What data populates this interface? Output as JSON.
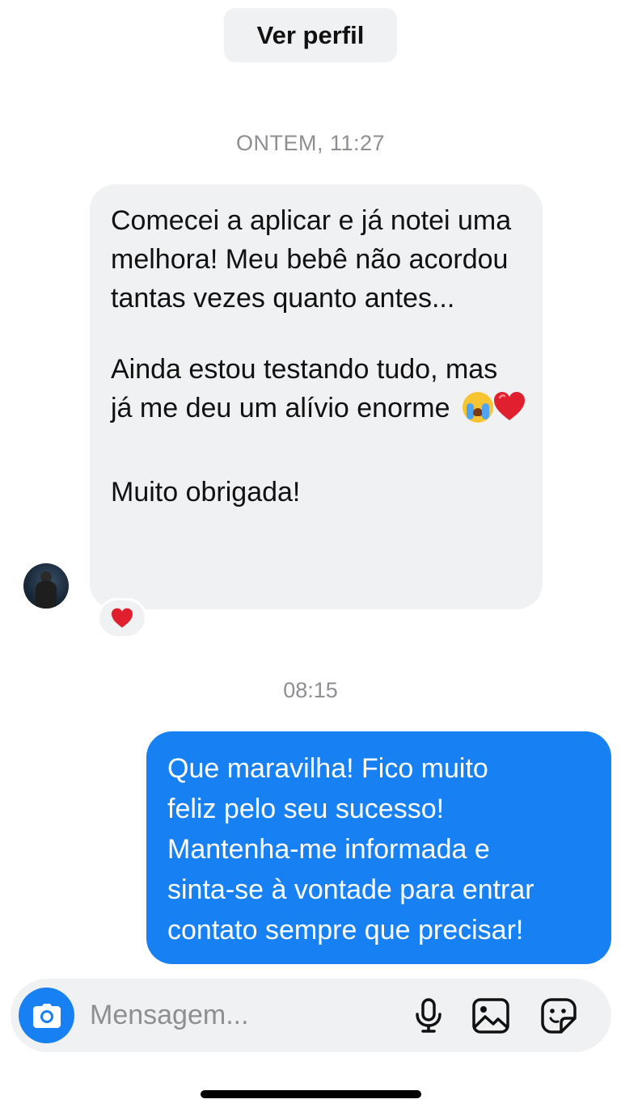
{
  "header": {
    "view_profile_label": "Ver perfil"
  },
  "conversation": {
    "timestamp_1": "ONTEM, 11:27",
    "incoming_message": {
      "paragraph_1": "Comecei a aplicar e já notei uma melhora! Meu bebê não acordou tantas vezes quanto antes...",
      "paragraph_2": "Ainda estou testando tudo, mas já me deu um alívio enorme",
      "paragraph_2_emojis": [
        "sob-emoji",
        "red-heart-emoji"
      ],
      "paragraph_3": "Muito obrigada!",
      "reaction": "red-heart-emoji"
    },
    "timestamp_2": "08:15",
    "outgoing_message": {
      "text": "Que maravilha! Fico muito\nfeliz pelo seu sucesso!\nMantenha-me informada e\nsinta-se à vontade para entrar\ncontato sempre que precisar!"
    }
  },
  "composer": {
    "placeholder": "Mensagem...",
    "value": "",
    "icons": [
      "camera-icon",
      "microphone-icon",
      "gallery-icon",
      "sticker-icon"
    ]
  },
  "colors": {
    "outgoing_bubble": "#1780f3",
    "incoming_bubble": "#eff1f3",
    "timestamp": "#8e8e93",
    "heart": "#e0202e"
  }
}
